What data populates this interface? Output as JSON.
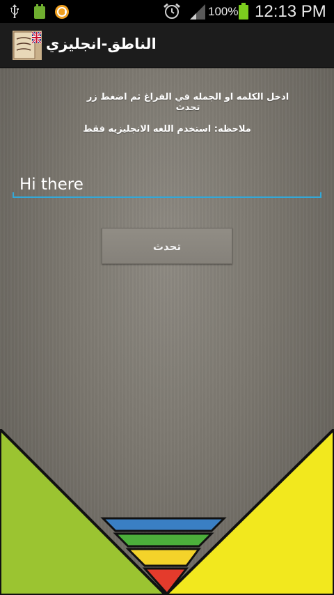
{
  "status_bar": {
    "battery_percent": "100%",
    "time": "12:13 PM",
    "icons": [
      "usb-icon",
      "android-debug-icon",
      "app-notification-icon",
      "alarm-icon",
      "signal-icon",
      "battery-icon"
    ]
  },
  "action_bar": {
    "title": "الناطق-انجليزي",
    "icon": "app-icon"
  },
  "main": {
    "instruction": "ادخل الكلمه او الجمله في الفراغ ثم اضغط زر تحدث",
    "note": "ملاحظه: استخدم اللغه الانجليزيه فقط",
    "input_value": "Hi there",
    "speak_button_label": "تحدث"
  },
  "colors": {
    "accent": "#33a8d8",
    "triangle_left": "#9bc431",
    "triangle_right": "#f2e81e",
    "stripe_blue": "#3a7fc4",
    "stripe_green": "#4caf3b",
    "stripe_yellow": "#f4d32a",
    "stripe_red": "#e43b2c"
  }
}
